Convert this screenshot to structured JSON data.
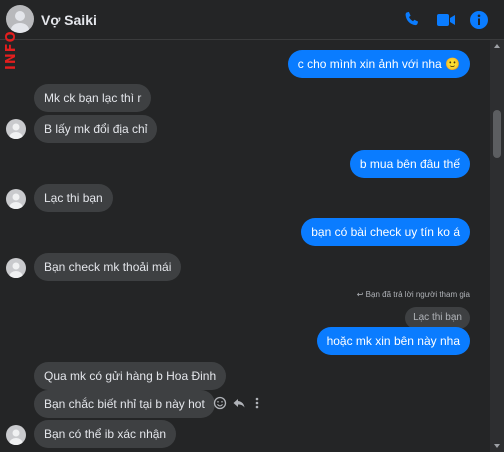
{
  "header": {
    "title": "Vợ Saiki",
    "watermark": "INFO"
  },
  "messages": [
    {
      "id": "m1",
      "text": "c cho mình xin ảnh với nha 🙂",
      "from": "self"
    },
    {
      "id": "m2",
      "text": "Mk ck bạn lạc thì r",
      "from": "other"
    },
    {
      "id": "m3",
      "text": "B lấy mk đổi địa chỉ",
      "from": "other"
    },
    {
      "id": "m4",
      "text": "b mua bên đâu thế",
      "from": "self"
    },
    {
      "id": "m5",
      "text": "Lạc thi bạn",
      "from": "other"
    },
    {
      "id": "m6",
      "text": "bạn có bài check uy tín ko á",
      "from": "self"
    },
    {
      "id": "m7",
      "text": "Bạn check mk thoải mái",
      "from": "other"
    },
    {
      "id": "m8",
      "text": "hoặc mk xin bên này nha",
      "from": "self"
    },
    {
      "id": "m9",
      "text": "Qua mk có gửi hàng b Hoa Đinh",
      "from": "other"
    },
    {
      "id": "m10",
      "text": "Bạn chắc biết nhỉ tại b này hot",
      "from": "other"
    },
    {
      "id": "m11",
      "text": "Bạn có thể ib xác nhận",
      "from": "other"
    }
  ],
  "reply": {
    "note": "Bạn đã trả lời người tham gia",
    "quoted": "Lạc thi bạn"
  },
  "colors": {
    "accent": "#0a7cff",
    "background": "#242526",
    "incoming_bubble": "#3e4042",
    "watermark": "#e41e1e"
  },
  "icons": [
    "phone-icon",
    "video-icon",
    "info-icon",
    "emoji-icon",
    "reply-icon",
    "more-icon"
  ]
}
